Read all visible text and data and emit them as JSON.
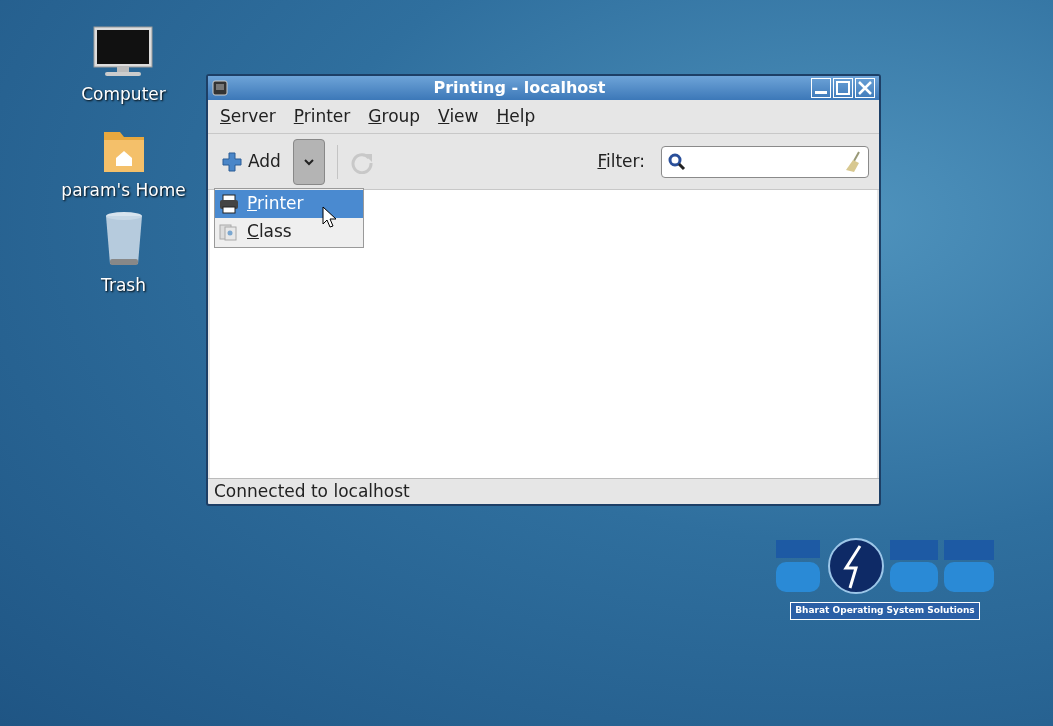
{
  "desktop_icons": [
    {
      "kind": "computer",
      "label": "Computer"
    },
    {
      "kind": "home",
      "label": "param's Home"
    },
    {
      "kind": "trash",
      "label": "Trash"
    }
  ],
  "window": {
    "title": "Printing - localhost",
    "menu": [
      {
        "mnemonic": "S",
        "rest": "erver"
      },
      {
        "mnemonic": "P",
        "rest": "rinter"
      },
      {
        "mnemonic": "G",
        "rest": "roup"
      },
      {
        "mnemonic": "V",
        "rest": "iew"
      },
      {
        "mnemonic": "H",
        "rest": "elp"
      }
    ],
    "toolbar": {
      "add_label": "Add",
      "add_menu_open": true,
      "filter_label": {
        "mnemonic": "F",
        "rest": "ilter:"
      }
    },
    "add_menu": [
      {
        "kind": "printer",
        "mnemonic": "P",
        "rest": "rinter",
        "selected": true
      },
      {
        "kind": "class",
        "mnemonic": "C",
        "rest": "lass",
        "selected": false
      }
    ],
    "status_bar": "Connected to localhost"
  },
  "wallpaper_logo": {
    "tagline": "Bharat Operating System Solutions"
  }
}
